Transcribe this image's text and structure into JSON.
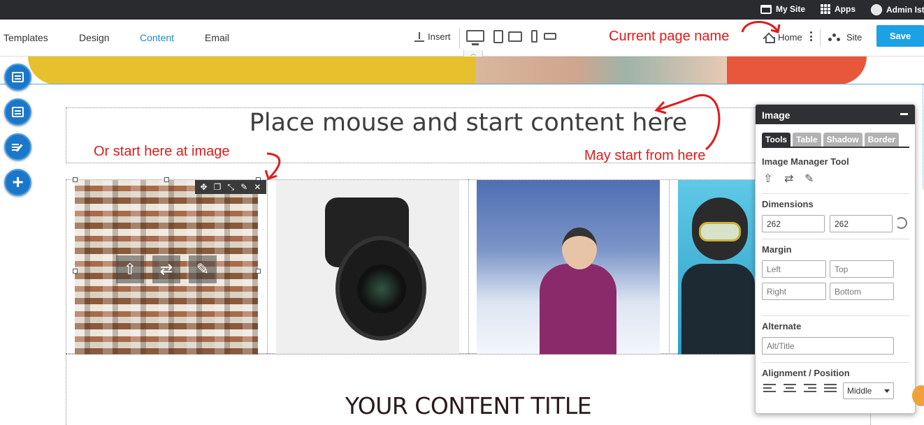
{
  "topbar": {
    "my_site": "My Site",
    "apps": "Apps",
    "admin": "Admin Istra"
  },
  "toolbar": {
    "tabs": [
      "Templates",
      "Design",
      "Content",
      "Email"
    ],
    "active_tab": "Content",
    "insert_label": "Insert",
    "home_label": "Home",
    "site_label": "Site",
    "save_label": "Save"
  },
  "annotations": {
    "page_name": "Current page name",
    "start_image": "Or start here at image",
    "start_here": "May start from here",
    "color": "#e01b1b"
  },
  "canvas": {
    "headline": "Place mouse and start content here",
    "content_title": "YOUR CONTENT TITLE"
  },
  "panel": {
    "title": "Image",
    "tabs": [
      "Tools",
      "Table",
      "Shadow",
      "Border"
    ],
    "active_tab": "Tools",
    "image_manager_label": "Image Manager Tool",
    "dimensions_label": "Dimensions",
    "width_value": "262",
    "height_value": "262",
    "margin_label": "Margin",
    "margin_left_placeholder": "Left",
    "margin_top_placeholder": "Top",
    "margin_right_placeholder": "Right",
    "margin_bottom_placeholder": "Bottom",
    "alternate_label": "Alternate",
    "alt_placeholder": "Alt/Title",
    "alignment_label": "Alignment / Position",
    "position_value": "Middle"
  },
  "colors": {
    "accent": "#1da1e6",
    "active_tab": "#1f86d0",
    "fab": "#1a77c9",
    "topbar": "#2a2b2f"
  }
}
